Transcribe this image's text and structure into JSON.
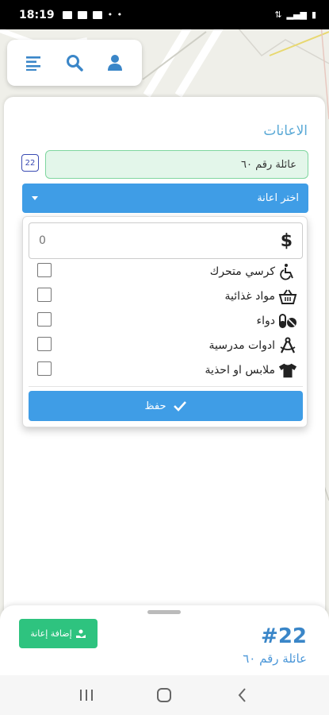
{
  "status_bar": {
    "time": "18:19"
  },
  "toolbar": {
    "menu_icon": "menu-icon",
    "search_icon": "search-icon",
    "user_icon": "user-icon"
  },
  "panel": {
    "title": "الاعانات",
    "badge": "22",
    "family_name": "عائلة رقم ٦٠",
    "select_label": "اختر اعانة"
  },
  "dropdown": {
    "amount_placeholder": "0",
    "currency_symbol": "$",
    "items": [
      {
        "label": "كرسي متحرك",
        "icon": "wheelchair-icon"
      },
      {
        "label": "مواد غذائية",
        "icon": "basket-icon"
      },
      {
        "label": "دواء",
        "icon": "pills-icon"
      },
      {
        "label": "ادوات مدرسية",
        "icon": "drafting-compass-icon"
      },
      {
        "label": "ملابس او احذية",
        "icon": "tshirt-icon"
      }
    ],
    "save_label": "حفظ"
  },
  "sheet": {
    "add_label": "إضافة إعانة",
    "family_number": "#22",
    "family_name": "عائلة رقم ٦٠"
  },
  "colors": {
    "accent": "#3f9de6",
    "green": "#2ec37f",
    "title": "#5aa9d6"
  }
}
